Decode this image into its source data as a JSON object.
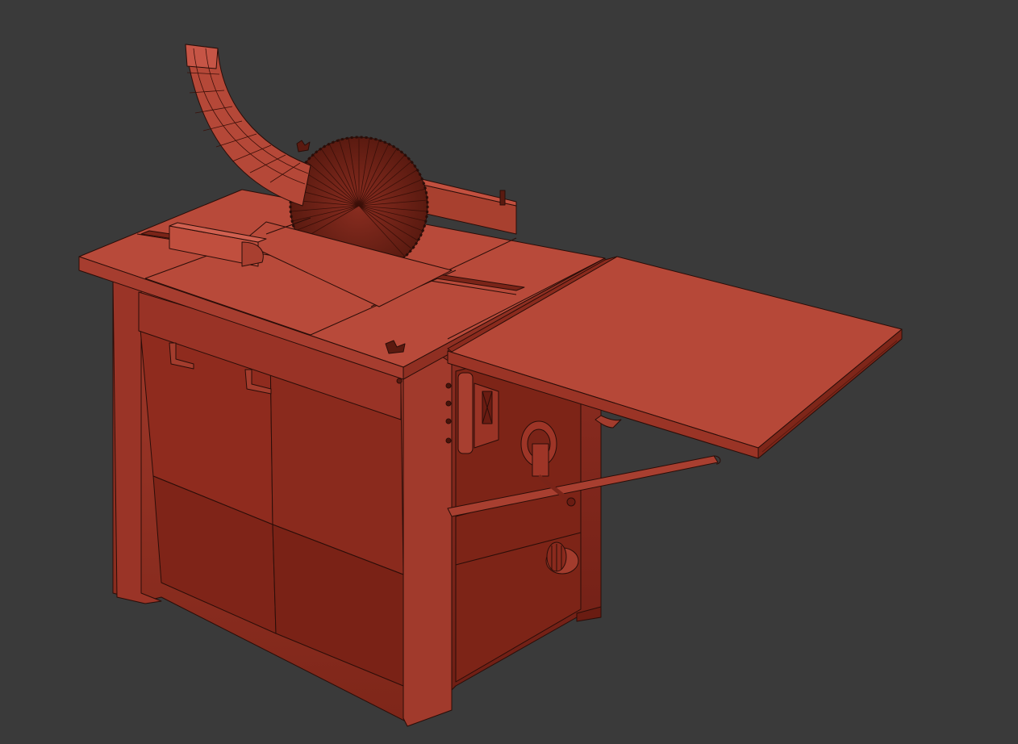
{
  "scene": {
    "background": "#3a3a3a",
    "model_color": "#b84a3a",
    "model_color_dark": "#7a2418",
    "model_color_mid": "#9e3527",
    "wire_color": "#2a0d08"
  }
}
